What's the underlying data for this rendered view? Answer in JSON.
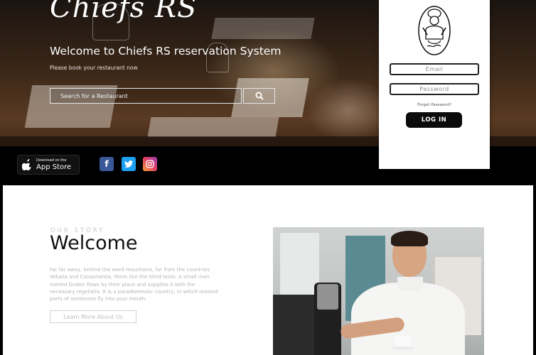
{
  "brand": {
    "logo_text": "Chiefs RS"
  },
  "hero": {
    "title": "Welcome to Chiefs RS reservation System",
    "subtitle": "Please book your restaurant now",
    "search": {
      "placeholder": "Search for a Restaurant"
    }
  },
  "footer_bar": {
    "app_store": {
      "small": "Download on the",
      "big": "App Store"
    },
    "social": [
      "facebook",
      "twitter",
      "instagram"
    ]
  },
  "login": {
    "email_placeholder": "Email",
    "password_placeholder": "Password",
    "forgot_label": "Forgot Password?",
    "login_button": "LOG IN"
  },
  "about": {
    "kicker": "OUR STORY",
    "title": "Welcome",
    "body": "Far far away, behind the word mountains, far from the countries Vokalia and Consonantia, there live the blind texts. A small river named Duden flows by their place and supplies it with the necessary regelialia. It is a paradisematic country, in which roasted parts of sentences fly into your mouth.",
    "more_button": "Learn More About Us"
  }
}
